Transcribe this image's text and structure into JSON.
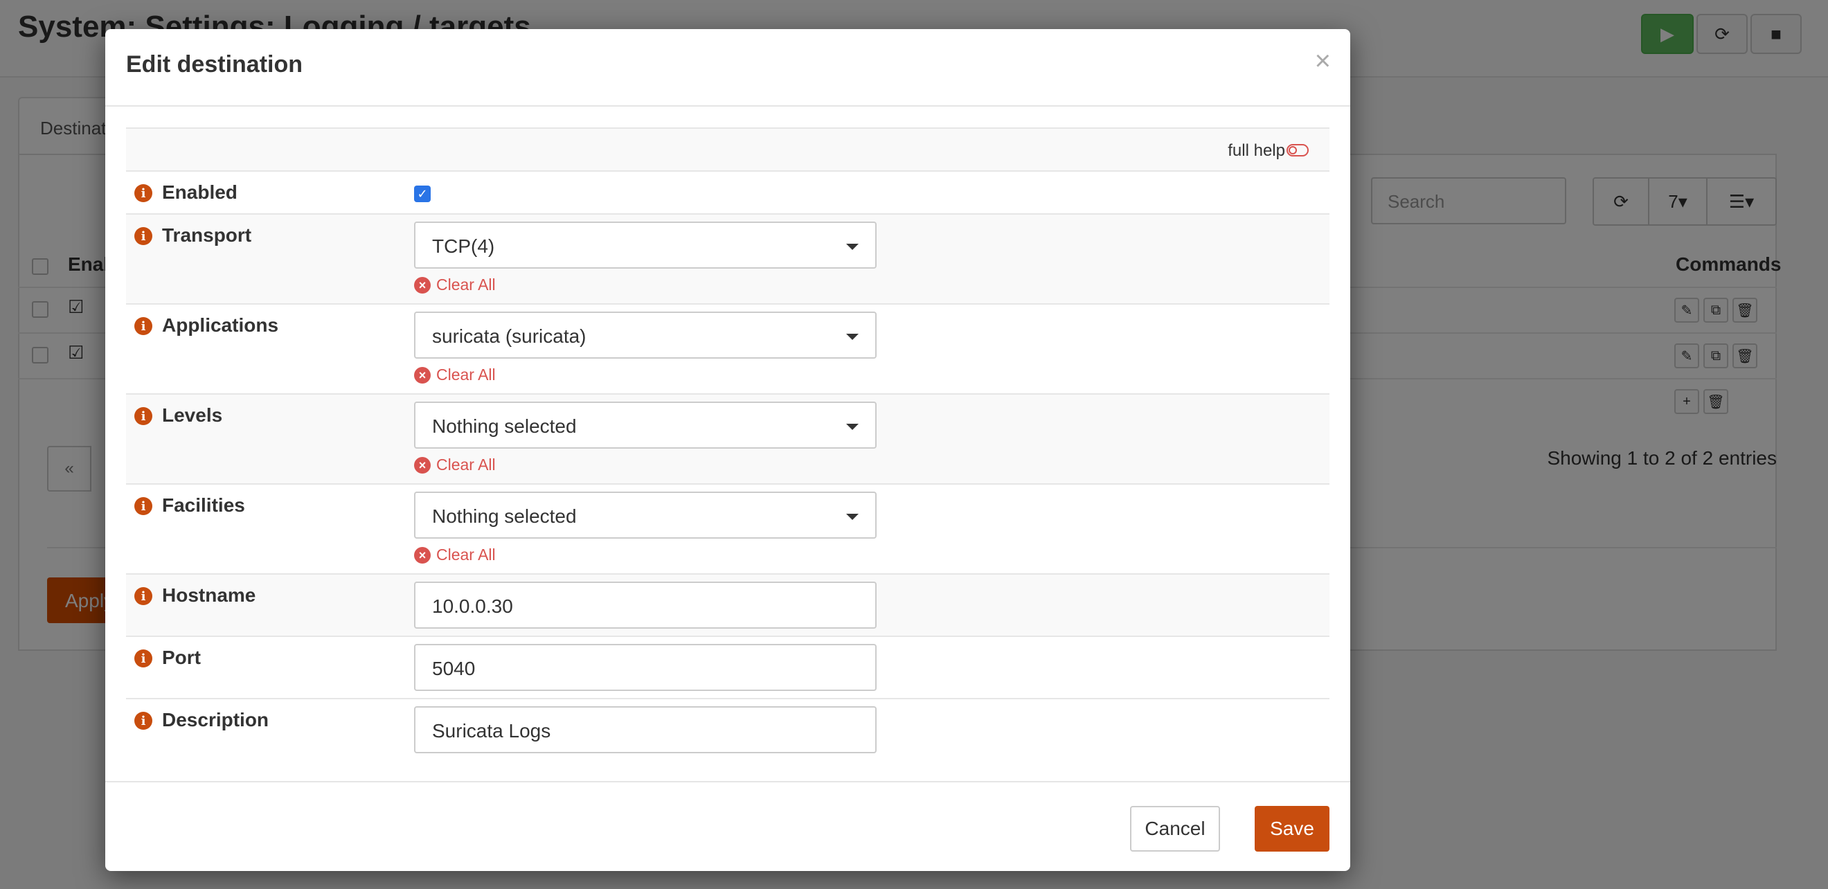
{
  "page": {
    "title": "System: Settings: Logging / targets",
    "tab_label": "Destinations",
    "search_placeholder": "Search",
    "page_size": "7",
    "columns": {
      "enabled": "Enab",
      "commands": "Commands"
    },
    "rows": [
      {
        "enabled": true
      },
      {
        "enabled": true
      }
    ],
    "pager_prev": "«",
    "entries_info": "Showing 1 to 2 of 2 entries",
    "apply_label": "Apply"
  },
  "modal": {
    "title": "Edit destination",
    "close": "×",
    "full_help_label": "full help",
    "fields": {
      "enabled": {
        "label": "Enabled",
        "checked": true
      },
      "transport": {
        "label": "Transport",
        "value": "TCP(4)",
        "clear": "Clear All"
      },
      "applications": {
        "label": "Applications",
        "value": "suricata (suricata)",
        "clear": "Clear All"
      },
      "levels": {
        "label": "Levels",
        "value": "Nothing selected",
        "clear": "Clear All"
      },
      "facilities": {
        "label": "Facilities",
        "value": "Nothing selected",
        "clear": "Clear All"
      },
      "hostname": {
        "label": "Hostname",
        "value": "10.0.0.30"
      },
      "port": {
        "label": "Port",
        "value": "5040"
      },
      "description": {
        "label": "Description",
        "value": "Suricata Logs"
      }
    },
    "cancel_label": "Cancel",
    "save_label": "Save"
  },
  "colors": {
    "accent": "#c84d0e",
    "danger": "#d9534f",
    "checkbox": "#2a74e6",
    "play": "#5cb85c"
  }
}
